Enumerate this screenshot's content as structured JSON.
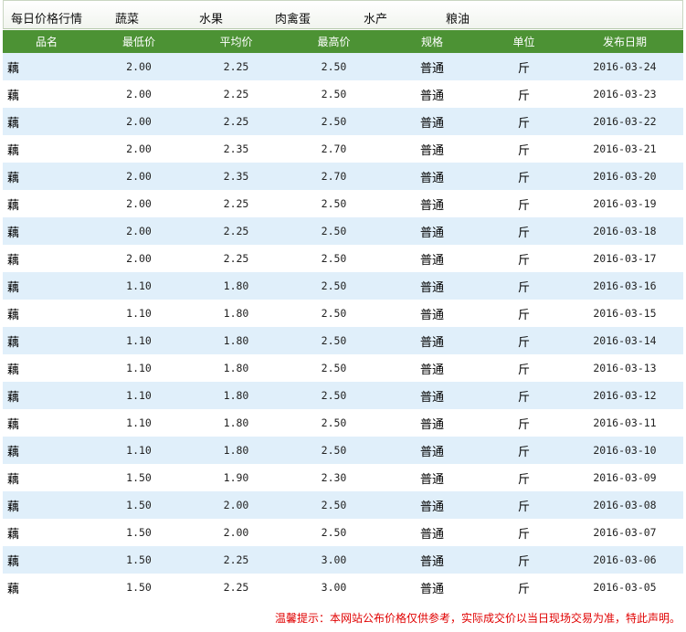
{
  "nav": {
    "title": "每日价格行情",
    "tabs": [
      "蔬菜",
      "水果",
      "肉禽蛋",
      "水产",
      "粮油"
    ]
  },
  "table": {
    "headers": [
      "品名",
      "最低价",
      "平均价",
      "最高价",
      "规格",
      "单位",
      "发布日期"
    ],
    "rows": [
      [
        "藕",
        "2.00",
        "2.25",
        "2.50",
        "普通",
        "斤",
        "2016-03-24"
      ],
      [
        "藕",
        "2.00",
        "2.25",
        "2.50",
        "普通",
        "斤",
        "2016-03-23"
      ],
      [
        "藕",
        "2.00",
        "2.25",
        "2.50",
        "普通",
        "斤",
        "2016-03-22"
      ],
      [
        "藕",
        "2.00",
        "2.35",
        "2.70",
        "普通",
        "斤",
        "2016-03-21"
      ],
      [
        "藕",
        "2.00",
        "2.35",
        "2.70",
        "普通",
        "斤",
        "2016-03-20"
      ],
      [
        "藕",
        "2.00",
        "2.25",
        "2.50",
        "普通",
        "斤",
        "2016-03-19"
      ],
      [
        "藕",
        "2.00",
        "2.25",
        "2.50",
        "普通",
        "斤",
        "2016-03-18"
      ],
      [
        "藕",
        "2.00",
        "2.25",
        "2.50",
        "普通",
        "斤",
        "2016-03-17"
      ],
      [
        "藕",
        "1.10",
        "1.80",
        "2.50",
        "普通",
        "斤",
        "2016-03-16"
      ],
      [
        "藕",
        "1.10",
        "1.80",
        "2.50",
        "普通",
        "斤",
        "2016-03-15"
      ],
      [
        "藕",
        "1.10",
        "1.80",
        "2.50",
        "普通",
        "斤",
        "2016-03-14"
      ],
      [
        "藕",
        "1.10",
        "1.80",
        "2.50",
        "普通",
        "斤",
        "2016-03-13"
      ],
      [
        "藕",
        "1.10",
        "1.80",
        "2.50",
        "普通",
        "斤",
        "2016-03-12"
      ],
      [
        "藕",
        "1.10",
        "1.80",
        "2.50",
        "普通",
        "斤",
        "2016-03-11"
      ],
      [
        "藕",
        "1.10",
        "1.80",
        "2.50",
        "普通",
        "斤",
        "2016-03-10"
      ],
      [
        "藕",
        "1.50",
        "1.90",
        "2.30",
        "普通",
        "斤",
        "2016-03-09"
      ],
      [
        "藕",
        "1.50",
        "2.00",
        "2.50",
        "普通",
        "斤",
        "2016-03-08"
      ],
      [
        "藕",
        "1.50",
        "2.00",
        "2.50",
        "普通",
        "斤",
        "2016-03-07"
      ],
      [
        "藕",
        "1.50",
        "2.25",
        "3.00",
        "普通",
        "斤",
        "2016-03-06"
      ],
      [
        "藕",
        "1.50",
        "2.25",
        "3.00",
        "普通",
        "斤",
        "2016-03-05"
      ]
    ]
  },
  "notice": "温馨提示：本网站公布价格仅供参考，实际成交价以当日现场交易为准，特此声明。",
  "colors": {
    "header_bg": "#4c9234",
    "row_alt_bg": "#e0effa",
    "notice_text": "#e00000"
  }
}
